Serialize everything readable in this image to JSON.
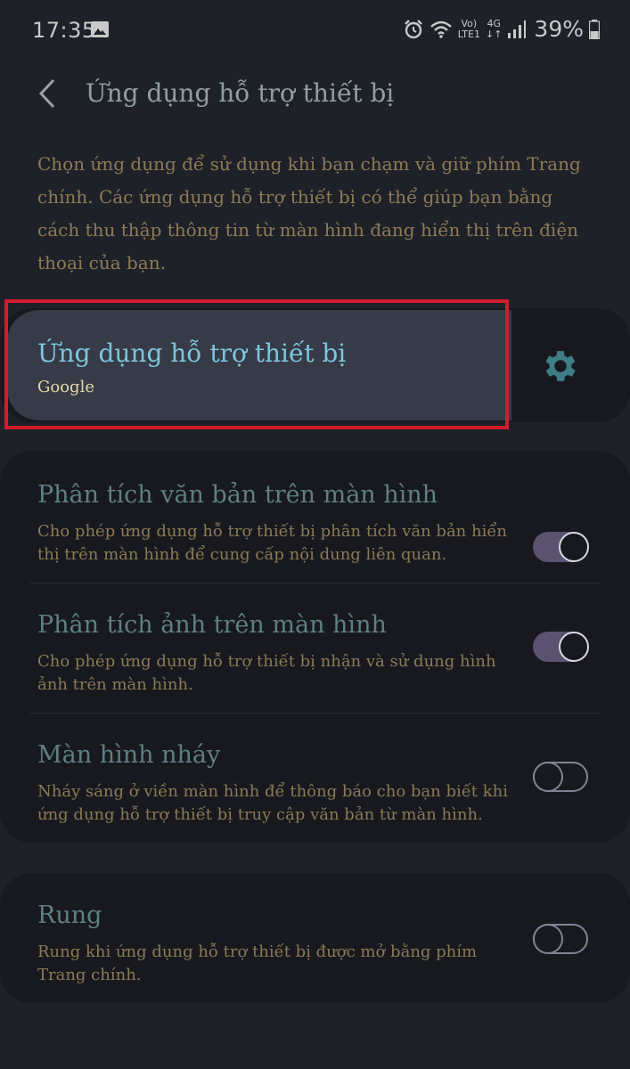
{
  "status_bar": {
    "time": "17:35",
    "network_top": "Vo)",
    "network_bottom": "LTE1",
    "network_type": "4G",
    "battery_percent": "39%"
  },
  "header": {
    "title": "Ứng dụng hỗ trợ thiết bị"
  },
  "description": "Chọn ứng dụng để sử dụng khi bạn chạm và giữ phím Trang chính. Các ứng dụng hỗ trợ thiết bị có thể giúp bạn bằng cách thu thập thông tin từ màn hình đang hiển thị trên điện thoại của bạn.",
  "assistant_app": {
    "title": "Ứng dụng hỗ trợ thiết bị",
    "value": "Google"
  },
  "options": [
    {
      "title": "Phân tích văn bản trên màn hình",
      "subtitle": "Cho phép ứng dụng hỗ trợ thiết bị phân tích văn bản hiển thị trên màn hình để cung cấp nội dung liên quan.",
      "enabled": true
    },
    {
      "title": "Phân tích ảnh trên màn hình",
      "subtitle": "Cho phép ứng dụng hỗ trợ thiết bị nhận và sử dụng hình ảnh trên màn hình.",
      "enabled": true
    },
    {
      "title": "Màn hình nháy",
      "subtitle": "Nháy sáng ở viền màn hình để thông báo cho bạn biết khi ứng dụng hỗ trợ thiết bị truy cập văn bản từ màn hình.",
      "enabled": false
    }
  ],
  "vibrate": {
    "title": "Rung",
    "subtitle": "Rung khi ứng dụng hỗ trợ thiết bị được mở bằng phím Trang chính.",
    "enabled": false
  },
  "colors": {
    "background": "#1f2129",
    "card": "#17191f",
    "highlight": "#d21c2b",
    "accent_title": "#7cc6de",
    "toggle_on": "#5b5270"
  },
  "icons": [
    "gallery-icon",
    "alarm-icon",
    "wifi-icon",
    "signal-icon",
    "battery-icon",
    "back-arrow-icon",
    "gear-icon"
  ]
}
